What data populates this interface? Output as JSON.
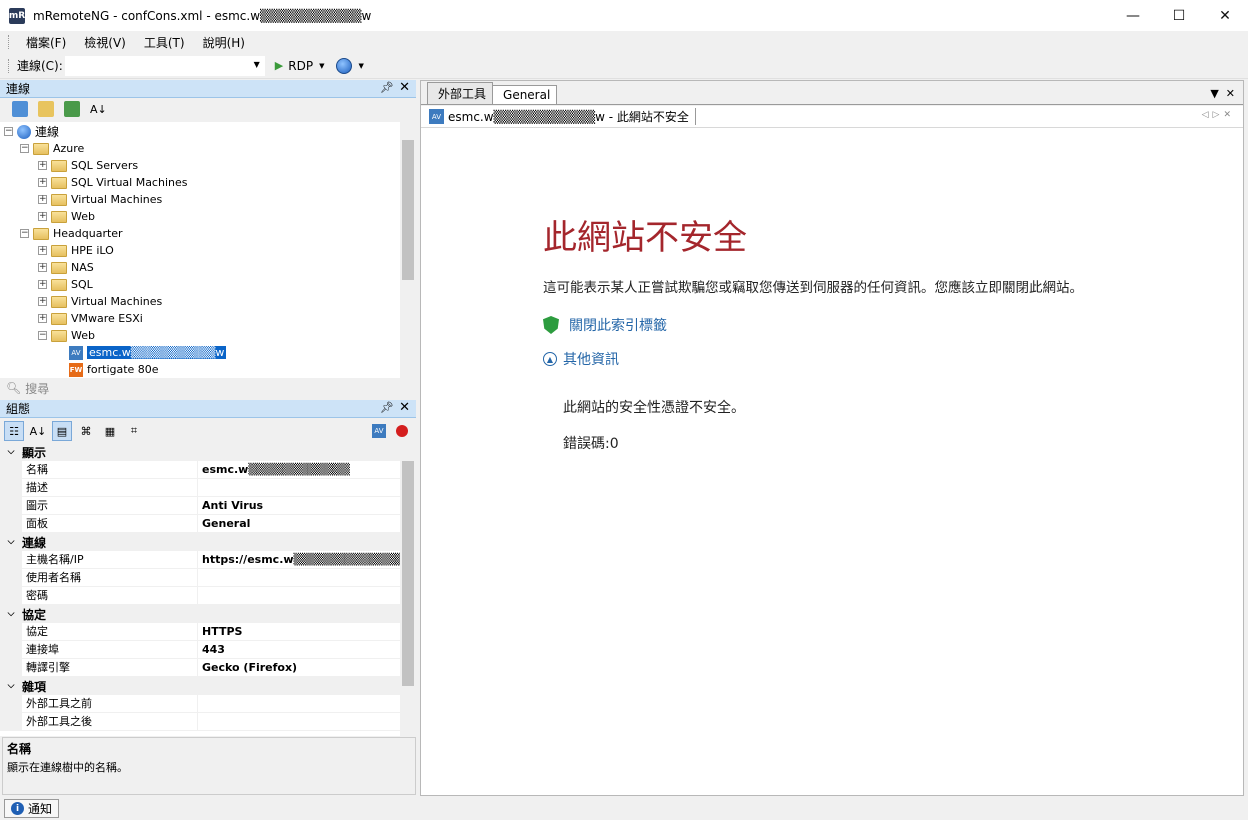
{
  "window": {
    "title": "mRemoteNG - confCons.xml - esmc.w▒▒▒▒▒▒▒▒▒▒▒w",
    "min": "—",
    "max": "☐",
    "close": "✕",
    "icon": "mR"
  },
  "menu": [
    "檔案(F)",
    "檢視(V)",
    "工具(T)",
    "說明(H)"
  ],
  "toolbar": {
    "connect_label": "連線(C):",
    "connect_value": "",
    "rdp_label": "RDP"
  },
  "connections_panel": {
    "title": "連線",
    "search_placeholder": "搜尋",
    "tree": [
      {
        "label": "連線",
        "type": "root"
      },
      {
        "label": "Azure",
        "type": "folder"
      },
      {
        "label": "SQL Servers",
        "type": "folder"
      },
      {
        "label": "SQL Virtual Machines",
        "type": "folder"
      },
      {
        "label": "Virtual Machines",
        "type": "folder"
      },
      {
        "label": "Web",
        "type": "folder"
      },
      {
        "label": "Headquarter",
        "type": "folder"
      },
      {
        "label": "HPE iLO",
        "type": "folder"
      },
      {
        "label": "NAS",
        "type": "folder"
      },
      {
        "label": "SQL",
        "type": "folder"
      },
      {
        "label": "Virtual Machines",
        "type": "folder"
      },
      {
        "label": "VMware ESXi",
        "type": "folder"
      },
      {
        "label": "Web",
        "type": "folder"
      },
      {
        "label": "esmc.w▒▒▒▒▒▒▒▒▒▒w",
        "type": "connection-av",
        "selected": true
      },
      {
        "label": "fortigate 80e",
        "type": "connection-fw"
      }
    ]
  },
  "config_panel": {
    "title": "組態",
    "categories": [
      {
        "name": "顯示",
        "rows": [
          {
            "name": "名稱",
            "value": "esmc.w▒▒▒▒▒▒▒▒▒▒▒▒"
          },
          {
            "name": "描述",
            "value": ""
          },
          {
            "name": "圖示",
            "value": "Anti Virus"
          },
          {
            "name": "面板",
            "value": "General"
          }
        ]
      },
      {
        "name": "連線",
        "rows": [
          {
            "name": "主機名稱/IP",
            "value": "https://esmc.w▒▒▒▒▒▒▒▒▒▒▒▒▒▒"
          },
          {
            "name": "使用者名稱",
            "value": ""
          },
          {
            "name": "密碼",
            "value": ""
          }
        ]
      },
      {
        "name": "協定",
        "rows": [
          {
            "name": "協定",
            "value": "HTTPS"
          },
          {
            "name": "連接埠",
            "value": "443"
          },
          {
            "name": "轉譯引擎",
            "value": "Gecko (Firefox)"
          }
        ]
      },
      {
        "name": "雜項",
        "rows": [
          {
            "name": "外部工具之前",
            "value": ""
          },
          {
            "name": "外部工具之後",
            "value": ""
          }
        ]
      }
    ],
    "desc_title": "名稱",
    "desc_text": "顯示在連線樹中的名稱。"
  },
  "doc_tabs": [
    "外部工具",
    "General"
  ],
  "conn_tab": {
    "label": "esmc.w▒▒▒▒▒▒▒▒▒▒▒w - 此網站不安全",
    "icon": "AV"
  },
  "page": {
    "title": "此網站不安全",
    "description": "這可能表示某人正嘗試欺騙您或竊取您傳送到伺服器的任何資訊。您應該立即關閉此網站。",
    "close_tab": "關閉此索引標籤",
    "more_info": "其他資訊",
    "cert_message": "此網站的安全性憑證不安全。",
    "error_code": "錯誤碼:0"
  },
  "status": {
    "notify_label": "通知"
  }
}
